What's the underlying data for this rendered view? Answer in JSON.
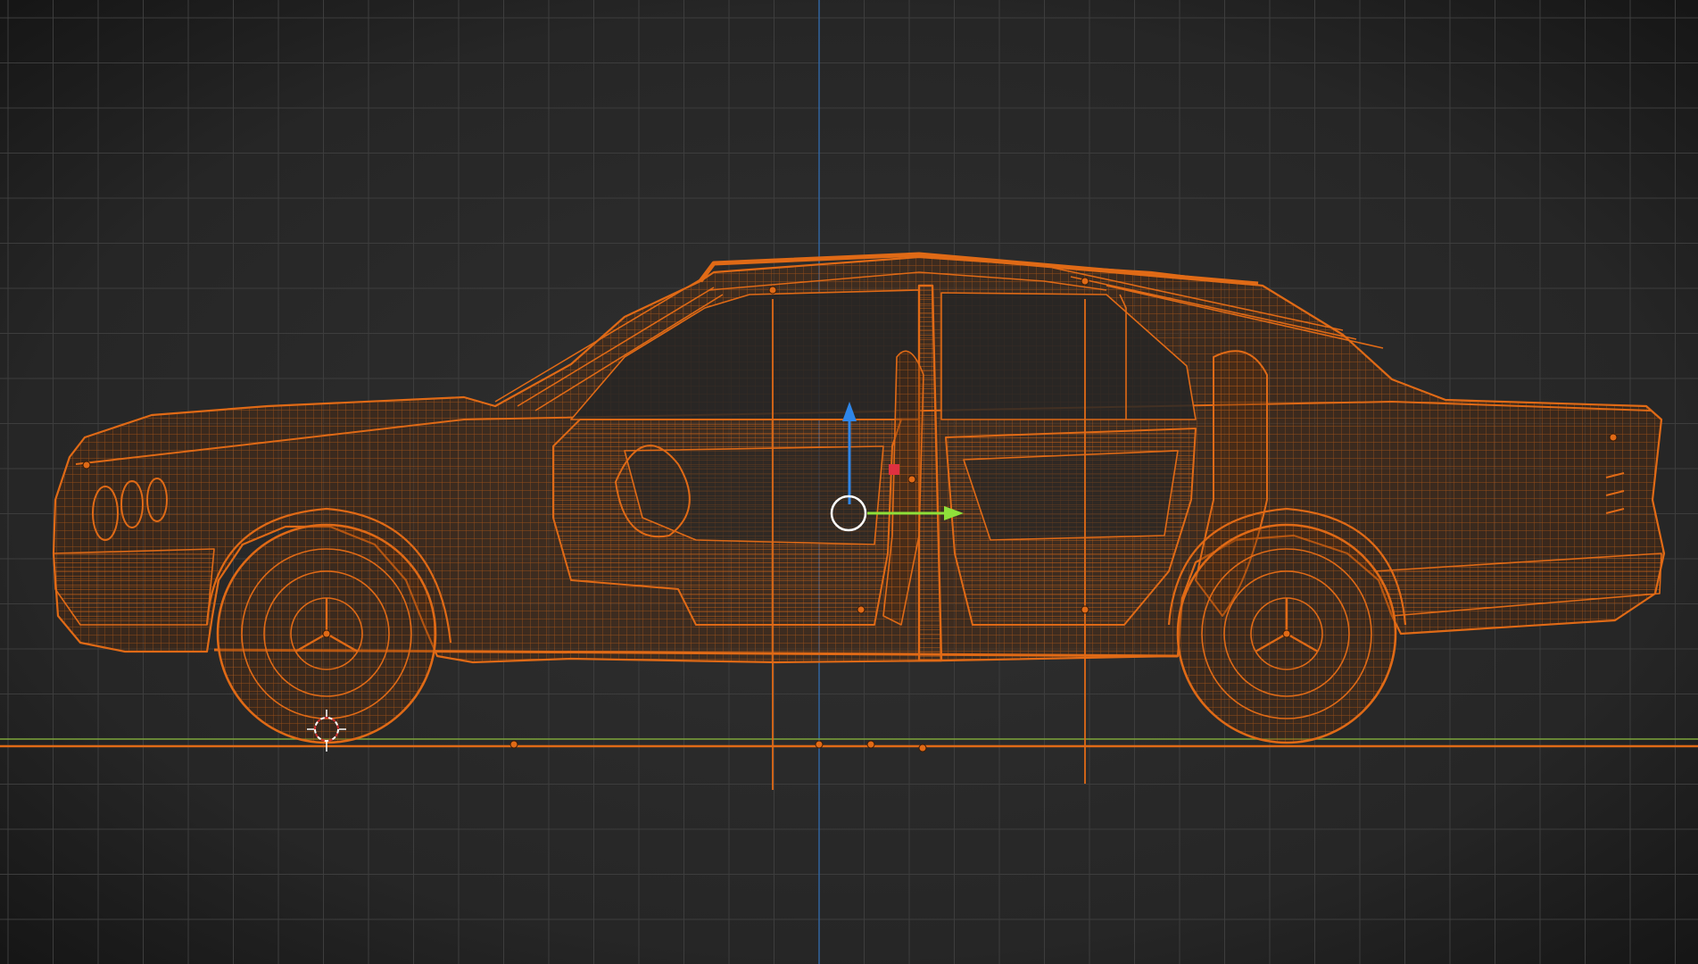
{
  "viewport": {
    "view": "side-orthographic",
    "shading": "wireframe",
    "colors": {
      "background_center": "#2e2e2e",
      "background_edge": "#1a1a1a",
      "grid_minor": "#343434",
      "grid_major": "#3d3d3d",
      "axis_x": "#7da53b",
      "axis_z": "#2f6fb8",
      "selection": "#e06a16",
      "selection_bright": "#ff8a2a",
      "gizmo_z": "#2f86e8",
      "gizmo_y": "#8ee03a",
      "gizmo_x": "#e03040",
      "gizmo_center": "#ffffff",
      "cursor": "#ffffff"
    }
  },
  "object": {
    "type": "car-sedan-4-door",
    "selected": true,
    "doors_open": 2
  },
  "gizmo": {
    "type": "translate",
    "axes": [
      "z",
      "y",
      "x"
    ]
  },
  "cursor_3d": {
    "visible": true
  }
}
